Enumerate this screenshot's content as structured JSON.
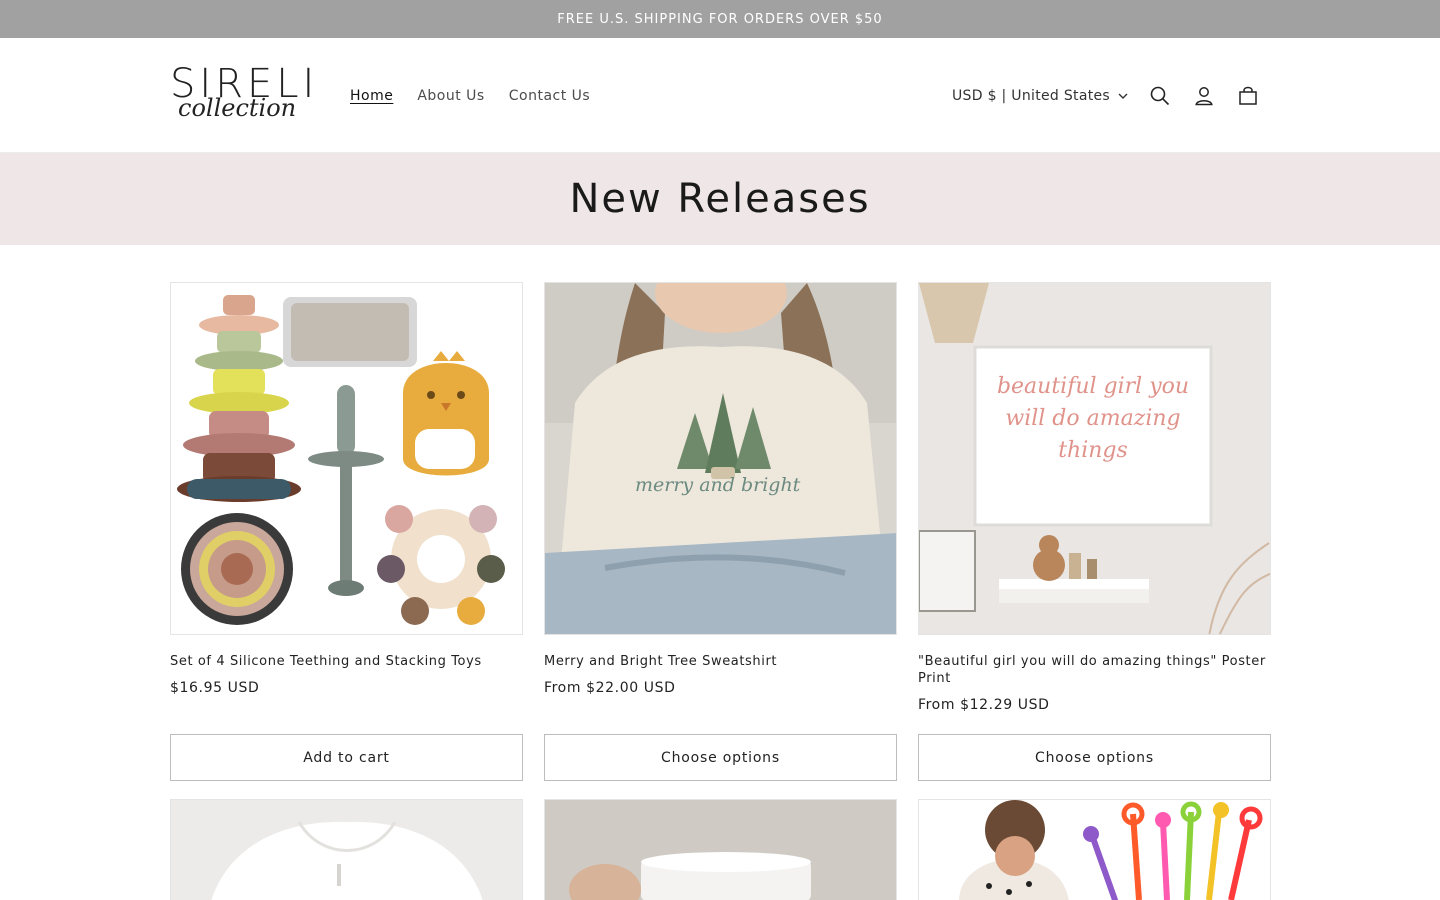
{
  "announcement": "FREE U.S. SHIPPING FOR ORDERS OVER $50",
  "logo": {
    "word": "SIRELI",
    "script": "collection"
  },
  "nav": [
    {
      "label": "Home"
    },
    {
      "label": "About Us"
    },
    {
      "label": "Contact Us"
    }
  ],
  "currency": "USD $ | United States",
  "icons": {
    "search": "search-icon",
    "account": "account-icon",
    "cart": "cart-icon",
    "chevron": "chevron-down-icon"
  },
  "page_title": "New Releases",
  "products": [
    {
      "title": "Set of 4 Silicone Teething and Stacking Toys",
      "price": "$16.95 USD",
      "button": "Add to cart",
      "image_text": ""
    },
    {
      "title": "Merry and Bright Tree Sweatshirt",
      "price": "From $22.00 USD",
      "button": "Choose options",
      "image_text": "merry and bright"
    },
    {
      "title": "\"Beautiful girl you will do amazing things\" Poster Print",
      "price": "From $12.29 USD",
      "button": "Choose options",
      "image_text": "beautiful girl you will do amazing things"
    }
  ],
  "colors": {
    "announcement_bg": "#a1a1a1",
    "banner_bg": "#efe7e7"
  }
}
